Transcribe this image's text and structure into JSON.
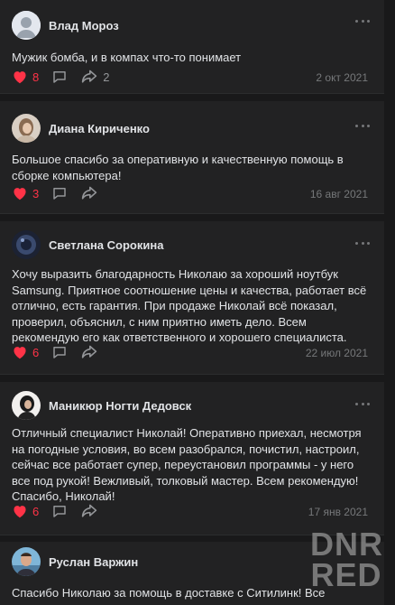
{
  "posts": [
    {
      "author": "Влад Мороз",
      "text": "Мужик бомба, и в компах что-то понимает",
      "likes": "8",
      "reposts": "2",
      "date": "2 окт 2021",
      "avatar": "placeholder-avatar"
    },
    {
      "author": "Диана Кириченко",
      "text": "Большое спасибо за оперативную и качественную помощь в сборке компьютера!",
      "likes": "3",
      "reposts": "",
      "date": "16 авг 2021",
      "avatar": "photo-avatar-light"
    },
    {
      "author": "Светлана Сорокина",
      "text": "Хочу выразить благодарность Николаю за хороший ноутбук Samsung. Приятное соотношение цены и качества, работает всё отлично, есть гарантия. При продаже Николай всё показал, проверил, объяснил, с ним приятно иметь дело. Всем рекомендую его как ответственного и хорошего специалиста.",
      "likes": "6",
      "reposts": "",
      "date": "22 июл 2021",
      "avatar": "photo-avatar-dark"
    },
    {
      "author": "Маникюр Ногти Дедовск",
      "text": "Отличный специалист Николай! Оперативно приехал, несмотря на погодные условия, во всем разобрался, почистил, настроил, сейчас все работает супер, переустановил программы - у него все под рукой! Вежливый, толковый мастер. Всем рекомендую!\nСпасибо, Николай!",
      "likes": "6",
      "reposts": "",
      "date": "17 янв 2021",
      "avatar": "photo-avatar-woman"
    },
    {
      "author": "Руслан Варжин",
      "text": "Спасибо Николаю за помощь в доставке с Ситилинк! Все прошло отлично!",
      "likes": "",
      "reposts": "",
      "date": "",
      "avatar": "photo-avatar-man"
    }
  ],
  "watermark": {
    "line1": "DNR",
    "line2": "RED"
  },
  "colors": {
    "background": "#19191a",
    "card": "#222223",
    "like": "#ff3347",
    "meta": "#76787a",
    "text": "#e1e3e6"
  },
  "icons": [
    "heart-icon",
    "comment-icon",
    "share-icon",
    "more-icon"
  ]
}
